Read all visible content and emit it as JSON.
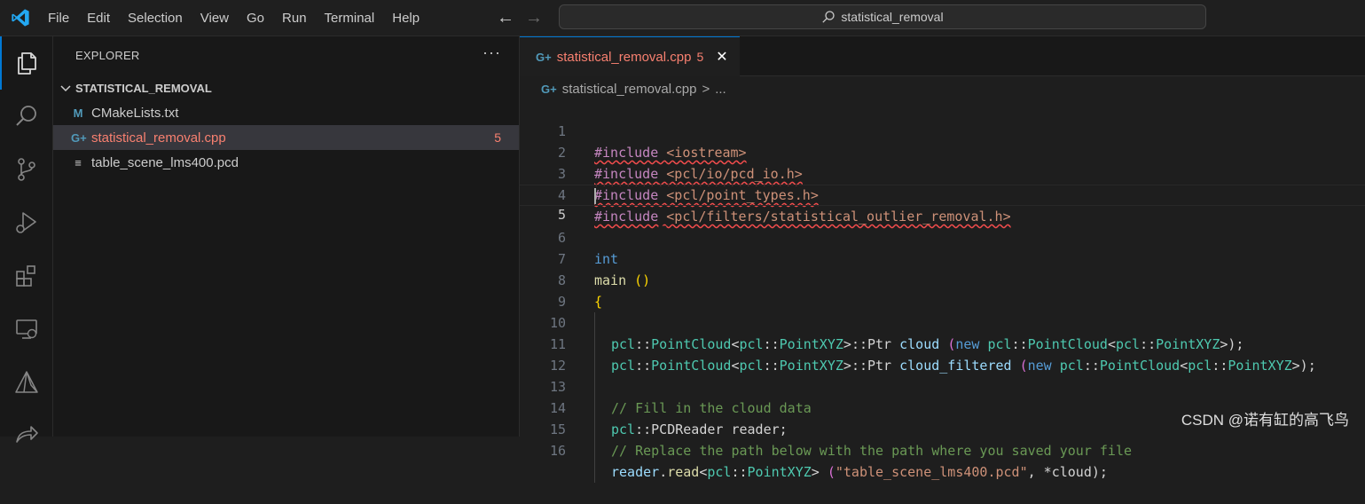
{
  "titlebar": {
    "menu": [
      "File",
      "Edit",
      "Selection",
      "View",
      "Go",
      "Run",
      "Terminal",
      "Help"
    ],
    "search_text": "statistical_removal"
  },
  "activity": {
    "icons": [
      "explorer-icon",
      "search-icon",
      "source-control-icon",
      "run-debug-icon",
      "extensions-icon",
      "remote-explorer-icon",
      "cmake-icon",
      "live-share-icon"
    ]
  },
  "explorer": {
    "header": "EXPLORER",
    "more": "···",
    "folder": "STATISTICAL_REMOVAL",
    "files": [
      {
        "icon": "M",
        "name": "CMakeLists.txt",
        "badge": ""
      },
      {
        "icon": "G+",
        "name": "statistical_removal.cpp",
        "badge": "5"
      },
      {
        "icon": "≡",
        "name": "table_scene_lms400.pcd",
        "badge": ""
      }
    ]
  },
  "editor": {
    "tab": {
      "label": "statistical_removal.cpp",
      "badge": "5",
      "close": "✕"
    },
    "breadcrumb": {
      "file": "statistical_removal.cpp",
      "sep": ">",
      "rest": "..."
    },
    "line_numbers": [
      "1",
      "2",
      "3",
      "4",
      "5",
      "6",
      "7",
      "8",
      "9",
      "10",
      "11",
      "12",
      "13",
      "14",
      "15",
      "16"
    ]
  },
  "code": {
    "l1": {
      "pre": "#include",
      "inc": "<iostream>"
    },
    "l2": {
      "pre": "#include",
      "inc": "<pcl/io/pcd_io.h>"
    },
    "l3": {
      "pre": "#include",
      "inc": "<pcl/point_types.h>"
    },
    "l4": {
      "pre": "#include",
      "inc": "<pcl/filters/statistical_outlier_removal.h>"
    },
    "l6": {
      "type": "int"
    },
    "l7": {
      "fn": "main",
      "paren": "()"
    },
    "l8": {
      "brace": "{"
    },
    "l9": {
      "ns1": "pcl",
      "sep": "::",
      "cls1": "PointCloud",
      "lt": "<",
      "ns2": "pcl",
      "cls2": "PointXYZ",
      "gt": ">",
      "ptr": "::Ptr",
      "var": "cloud",
      "op": "(",
      "new": "new",
      "ns3": "pcl",
      "cls3": "PointCloud",
      "ns4": "pcl",
      "cls4": "PointXYZ",
      "close": ">);"
    },
    "l10": {
      "var": "cloud_filtered"
    },
    "l12": {
      "comment": "// Fill in the cloud data"
    },
    "l13": {
      "ns": "pcl",
      "cls": "PCDReader",
      "var": "reader;"
    },
    "l14": {
      "comment": "// Replace the path below with the path where you saved your file"
    },
    "l15": {
      "obj": "reader",
      "fn": "read",
      "ns": "pcl",
      "cls": "PointXYZ",
      "str": "\"table_scene_lms400.pcd\"",
      "rest": ", *cloud);"
    }
  },
  "watermark": "CSDN @诺有缸的高飞鸟",
  "colors": {
    "accent": "#0078d4",
    "error": "#f88070",
    "editor_bg": "#1e1e1e",
    "sidebar_bg": "#181818"
  }
}
